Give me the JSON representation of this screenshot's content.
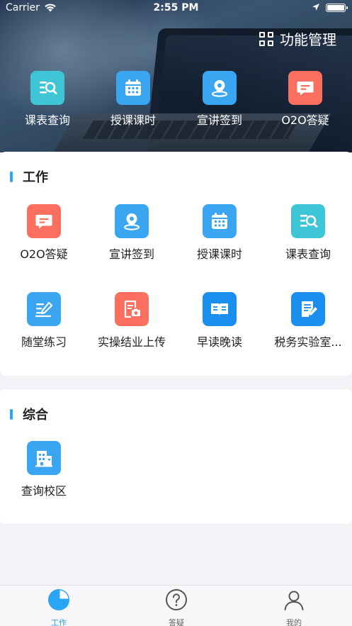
{
  "status_bar": {
    "carrier": "Carrier",
    "time": "2:55 PM"
  },
  "header": {
    "manage_label": "功能管理"
  },
  "quick_actions": [
    {
      "label": "课表查询",
      "icon": "schedule-search-icon",
      "color": "#3fc6d6"
    },
    {
      "label": "授课课时",
      "icon": "calendar-icon",
      "color": "#3aa6f2"
    },
    {
      "label": "宣讲签到",
      "icon": "location-pin-icon",
      "color": "#3aa6f2"
    },
    {
      "label": "O2O答疑",
      "icon": "chat-bubble-icon",
      "color": "#fa6f5f"
    }
  ],
  "work_section": {
    "title": "工作",
    "items": [
      {
        "label": "O2O答疑",
        "icon": "chat-bubble-icon",
        "color": "#fa6f5f"
      },
      {
        "label": "宣讲签到",
        "icon": "location-pin-icon",
        "color": "#3aa6f2"
      },
      {
        "label": "授课课时",
        "icon": "calendar-icon",
        "color": "#3aa6f2"
      },
      {
        "label": "课表查询",
        "icon": "schedule-search-icon",
        "color": "#3fc6d6"
      },
      {
        "label": "随堂练习",
        "icon": "pen-list-icon",
        "color": "#3aa6f2"
      },
      {
        "label": "实操结业上传",
        "icon": "camera-document-icon",
        "color": "#fa6f5f"
      },
      {
        "label": "早读晚读",
        "icon": "open-book-icon",
        "color": "#1a8ff0"
      },
      {
        "label": "税务实验室...",
        "icon": "edit-document-icon",
        "color": "#1a8ff0"
      }
    ]
  },
  "comprehensive_section": {
    "title": "综合",
    "items": [
      {
        "label": "查询校区",
        "icon": "building-icon",
        "color": "#3aa6f2"
      }
    ]
  },
  "tab_bar": {
    "tabs": [
      {
        "label": "工作",
        "icon": "pie-chart-icon",
        "active": true
      },
      {
        "label": "答疑",
        "icon": "question-circle-icon",
        "active": false
      },
      {
        "label": "我的",
        "icon": "user-icon",
        "active": false
      }
    ]
  },
  "colors": {
    "accent": "#2aa4f4",
    "teal": "#3fc6d6",
    "blue": "#3aa6f2",
    "red": "#fa6f5f",
    "dark_blue": "#1a8ff0"
  }
}
